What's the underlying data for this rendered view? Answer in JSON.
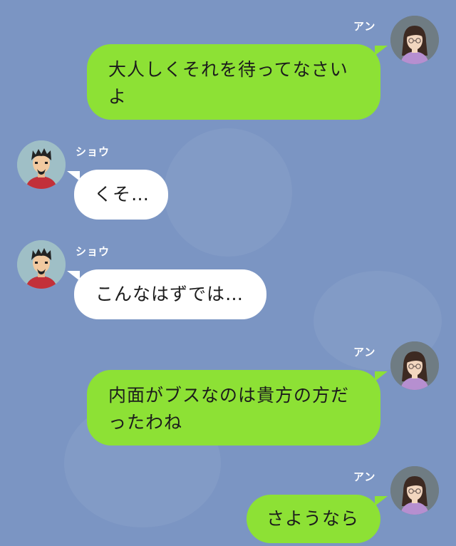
{
  "messages": [
    {
      "sender": "アン",
      "text": "大人しくそれを待ってなさいよ",
      "line1": "大人しくそれを待ってなさい",
      "line2": "よ",
      "side": "right"
    },
    {
      "sender": "ショウ",
      "text": "くそ…",
      "side": "left"
    },
    {
      "sender": "ショウ",
      "text": "こんなはずでは…",
      "side": "left"
    },
    {
      "sender": "アン",
      "text": "内面がブスなのは貴方の方だったわね",
      "line1": "内面がブスなのは貴方の方だ",
      "line2": "ったわね",
      "side": "right"
    },
    {
      "sender": "アン",
      "text": "さようなら",
      "side": "right"
    }
  ],
  "colors": {
    "background": "#7b95c3",
    "sent_bubble": "#8de135",
    "received_bubble": "#ffffff"
  },
  "icons": {
    "ann_avatar": "woman-with-glasses-avatar-icon",
    "sho_avatar": "man-with-beard-avatar-icon"
  }
}
